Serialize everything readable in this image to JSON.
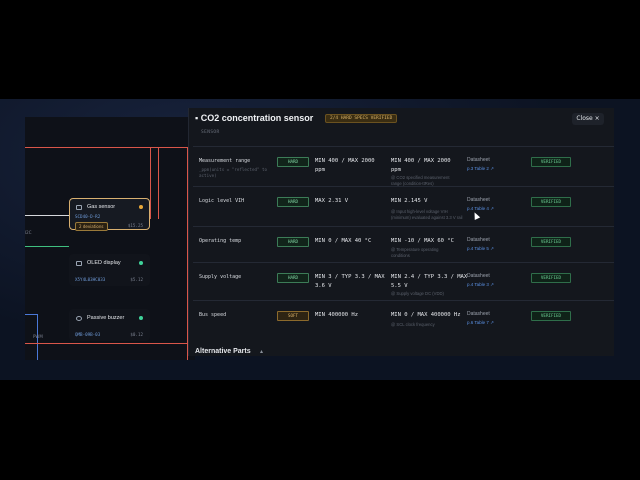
{
  "canvas": {
    "nodes": [
      {
        "title": "Gas sensor",
        "part": "SCD40-D-R2",
        "price": "$15.25",
        "badge": "2 deviations",
        "status_color": "#e8a83a"
      },
      {
        "title": "OLED display",
        "part": "X5Y4L03HC033",
        "price": "$5.12",
        "status_color": "#3fd39a"
      },
      {
        "title": "Passive buzzer",
        "part": "QMB-09B-03",
        "price": "$0.12",
        "status_color": "#3fd39a"
      }
    ],
    "edge_label": "I2C",
    "bottom_label": "PWM"
  },
  "modal": {
    "title": "CO2 concentration sensor",
    "header_badge": "2/4 HARD SPECS VERIFIED",
    "close_label": "Close",
    "close_icon": "×",
    "section_label": "SENSOR",
    "rows": [
      {
        "param": "Measurement range",
        "param_note": "_ppm(units = \"reflected\" to\nactive)",
        "tag": "HARD",
        "spec": "MIN 400 / MAX 2000\nppm",
        "measured": "MIN 400 / MAX 2000\nppm",
        "measured_note": "@ CO2 specified measurement\nrange (condition-ttRes)",
        "source": "Datasheet",
        "link": "p.3 Table 2 ↗",
        "status": "VERIFIED"
      },
      {
        "param": "Logic level VIH",
        "param_note": "",
        "tag": "HARD",
        "spec": "MAX 2.31 V",
        "measured": "MIN 2.145 V",
        "measured_note": "@ Input high-level voltage VIH\n(minimum) evaluated against 3.3 V rail",
        "source": "Datasheet",
        "link": "p.4 Table 4 ↗",
        "status": "VERIFIED"
      },
      {
        "param": "Operating temp",
        "param_note": "",
        "tag": "HARD",
        "spec": "MIN 0 / MAX 40 °C",
        "measured": "MIN -10 / MAX 60 °C",
        "measured_note": "@ Temperature operating\nconditions",
        "source": "Datasheet",
        "link": "p.4 Table 5 ↗",
        "status": "VERIFIED"
      },
      {
        "param": "Supply voltage",
        "param_note": "",
        "tag": "HARD",
        "spec": "MIN 3 / TYP 3.3 / MAX\n3.6 V",
        "measured": "MIN 2.4 / TYP 3.3 / MAX\n5.5 V",
        "measured_note": "@ Supply voltage DC (VDD)",
        "source": "Datasheet",
        "link": "p.4 Table 3 ↗",
        "status": "VERIFIED"
      },
      {
        "param": "Bus speed",
        "param_note": "",
        "tag": "SOFT",
        "spec": "MIN 400000 Hz",
        "measured": "MIN 0 / MAX 400000 Hz",
        "measured_note": "@ SCL clock frequency",
        "source": "Datasheet",
        "link": "p.6 Table 7 ↗",
        "status": "VERIFIED"
      }
    ],
    "alt_parts_label": "Alternative Parts",
    "alt_parts_icon": "chevron-up-icon"
  }
}
